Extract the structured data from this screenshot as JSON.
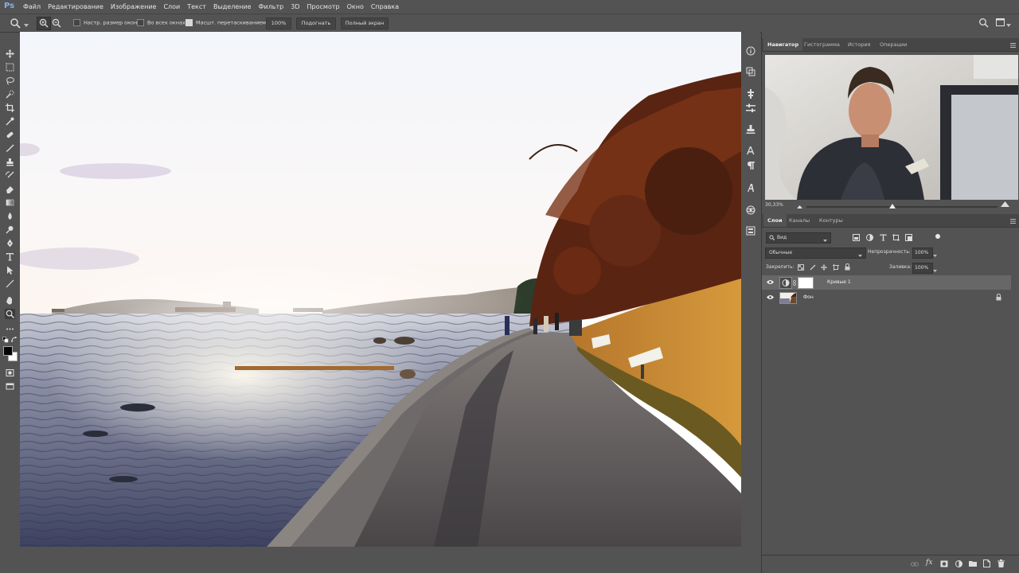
{
  "app": {
    "logo": "Ps"
  },
  "menu": [
    "Файл",
    "Редактирование",
    "Изображение",
    "Слои",
    "Текст",
    "Выделение",
    "Фильтр",
    "3D",
    "Просмотр",
    "Окно",
    "Справка"
  ],
  "options": {
    "resize_windows": "Настр. размер окон",
    "all_windows": "Во всех окнах",
    "scrubby_zoom": "Масшт. перетаскиванием",
    "zoom_value": "100%",
    "fit_button": "Подогнать",
    "fullscreen_button": "Полный экран"
  },
  "navigator": {
    "tabs": [
      "Навигатор",
      "Гистограмма",
      "История",
      "Операции"
    ],
    "zoom": "30,33%",
    "zoom_slider_fraction": 0.45
  },
  "layers_panel": {
    "tabs": [
      "Слои",
      "Каналы",
      "Контуры"
    ],
    "filter_kind": "Вид",
    "blend_mode": "Обычные",
    "opacity_label": "Непрозрачность:",
    "opacity_value": "100%",
    "lock_label": "Закрепить:",
    "fill_label": "Заливка:",
    "fill_value": "100%",
    "layers": [
      {
        "name": "Кривые 1",
        "selected": true
      },
      {
        "name": "Фон",
        "selected": false
      }
    ]
  },
  "colors": {
    "ui_bg": "#535353",
    "panel_dark": "#464646",
    "selected_layer": "#676767",
    "ps_blue": "#7fb4e8"
  }
}
